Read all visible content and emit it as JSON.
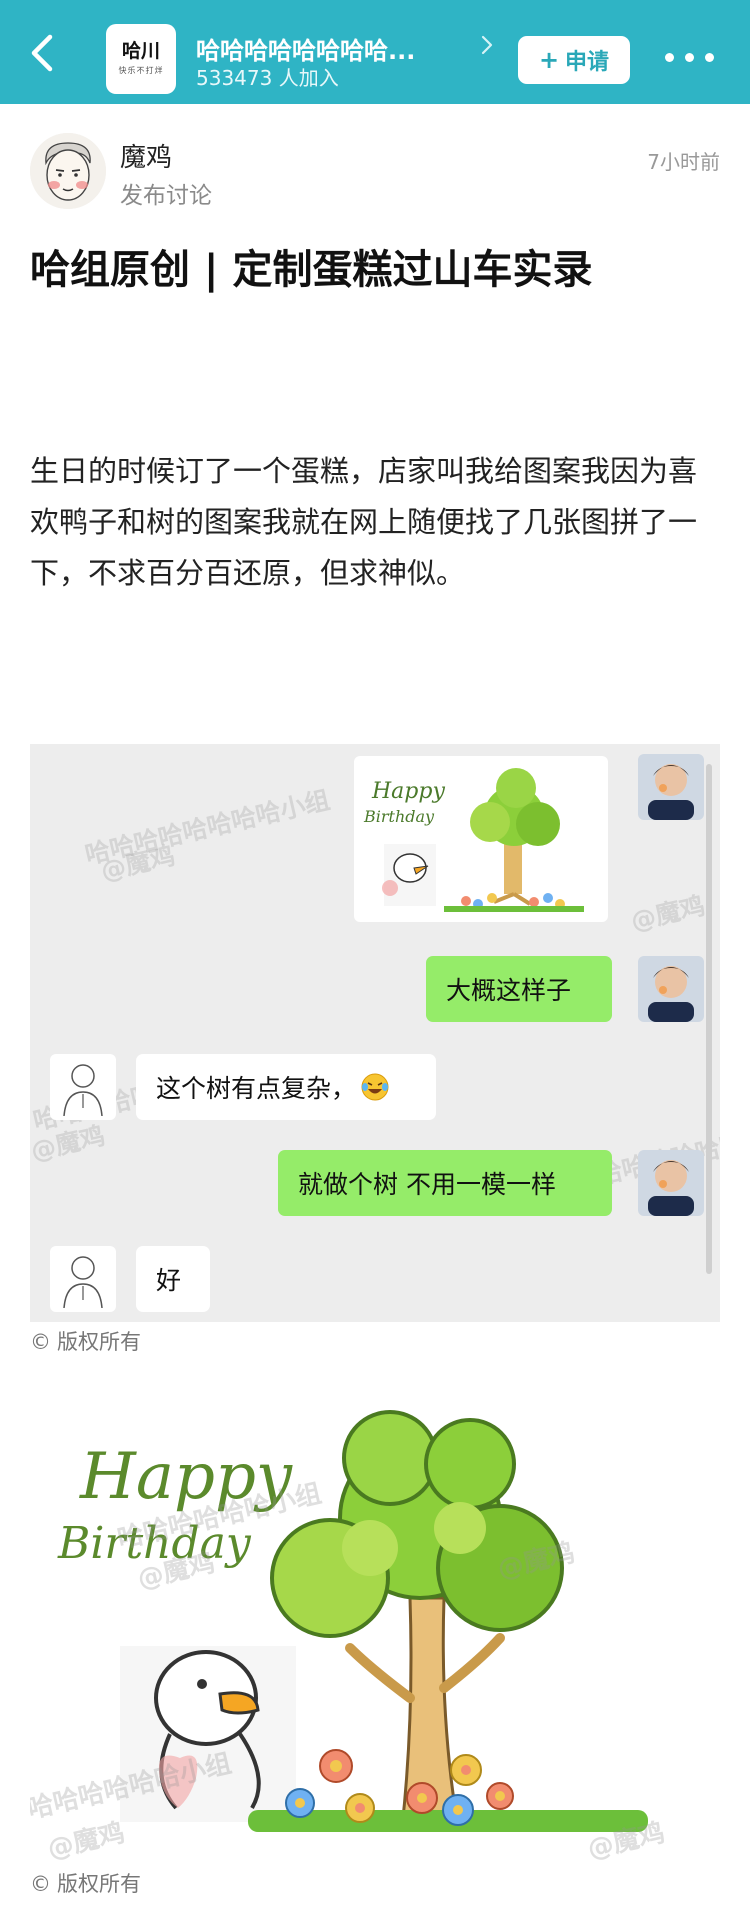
{
  "header": {
    "group_logo_text": "哈川",
    "group_logo_sub": "快乐不打烊",
    "group_name": "哈哈哈哈哈哈哈哈...",
    "member_count": "533473",
    "member_unit": " 人加入",
    "apply_label": "申请",
    "apply_icon": "plus-icon",
    "back_icon": "chevron-left-icon",
    "more_icon": "more-dots-icon",
    "brand_color": "#2fb4c5"
  },
  "post": {
    "author": "魔鸡",
    "action": "发布讨论",
    "time": "7小时前",
    "title": "哈组原创 | 定制蛋糕过山车实录",
    "body": "生日的时候订了一个蛋糕，店家叫我给图案我因为喜欢鸭子和树的图案我就在网上随便找了几张图拼了一下，不求百分百还原，但求神似。"
  },
  "chat": {
    "image_text_1": "Happy",
    "image_text_2": "Birthday",
    "messages": [
      {
        "from": "me",
        "text": "大概这样子"
      },
      {
        "from": "other",
        "text": "这个树有点复杂，"
      },
      {
        "from": "me",
        "text": "就做个树 不用一模一样"
      },
      {
        "from": "other",
        "text": "好"
      }
    ],
    "watermark_line1": "哈哈哈哈哈哈哈哈小组",
    "watermark_line2": "@魔鸡",
    "me_bubble_color": "#95ec69"
  },
  "copyright_1": "版权所有",
  "cake_image": {
    "text_1": "Happy",
    "text_2": "Birthday",
    "watermark_line1": "哈哈哈哈哈哈小组",
    "watermark_line2": "@魔鸡"
  },
  "copyright_2": "版权所有"
}
